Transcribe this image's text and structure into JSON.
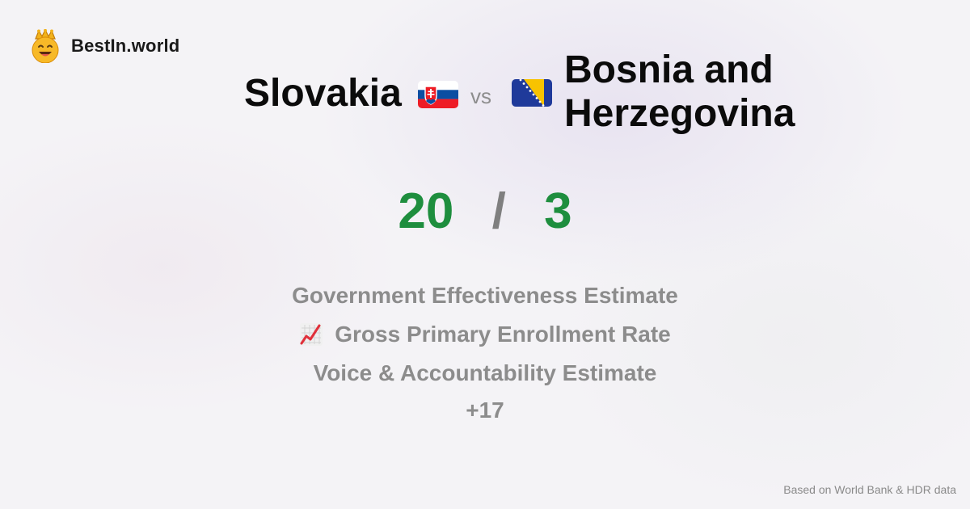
{
  "brand": {
    "name": "BestIn.world",
    "logo_icon": "crown-smiley-icon"
  },
  "comparison": {
    "country_a": "Slovakia",
    "country_b_line1": "Bosnia and",
    "country_b_line2": "Herzegovina",
    "vs_label": "vs",
    "flag_a": "slovakia-flag-icon",
    "flag_b": "bosnia-herzegovina-flag-icon"
  },
  "score": {
    "a": "20",
    "separator": "/",
    "b": "3",
    "color": "#1e8e3e"
  },
  "metrics": [
    {
      "label": "Government Effectiveness Estimate"
    },
    {
      "label": "Gross Primary Enrollment Rate",
      "icon": "chart-increasing-icon"
    },
    {
      "label": "Voice & Accountability Estimate"
    }
  ],
  "more_label": "+17",
  "footer": {
    "source": "Based on World Bank & HDR data"
  }
}
